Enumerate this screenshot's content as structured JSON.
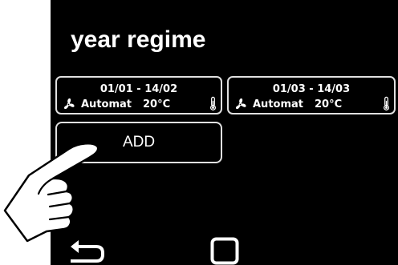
{
  "header": {
    "title": "year regime"
  },
  "regimes": [
    {
      "date_range": "01/01 - 14/02",
      "mode": "Automat",
      "temperature": "20°C",
      "mode_icon": "fan-icon",
      "temp_icon": "thermometer-icon"
    },
    {
      "date_range": "01/03 - 14/03",
      "mode": "Automat",
      "temperature": "20°C",
      "mode_icon": "fan-icon",
      "temp_icon": "thermometer-icon"
    }
  ],
  "actions": {
    "add_label": "ADD"
  },
  "nav": {
    "back_icon": "back-arrow-icon",
    "home_icon": "home-square-icon"
  },
  "overlay": {
    "pointer_icon": "pointing-hand-icon"
  },
  "colors": {
    "screen_background": "#000000",
    "foreground": "#ffffff",
    "border": "#e0e0e0",
    "margin_background": "#ffffff"
  }
}
